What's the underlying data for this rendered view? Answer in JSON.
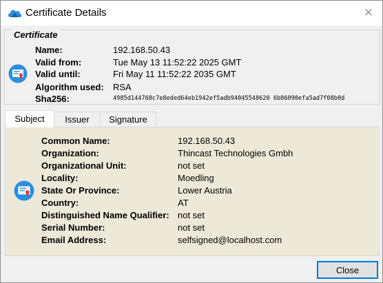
{
  "window": {
    "title": "Certificate Details",
    "close_glyph": "✕"
  },
  "certificate": {
    "legend": "Certificate",
    "fields": [
      {
        "label": "Name:",
        "value": "192.168.50.43"
      },
      {
        "label": "Valid from:",
        "value": "Tue May 13 11:52:22 2025 GMT"
      },
      {
        "label": "Valid until:",
        "value": "Fri May 11 11:52:22 2035 GMT"
      },
      {
        "label": "Algorithm used:",
        "value": "RSA"
      },
      {
        "label": "Sha256:",
        "value": "4985d144768c7e8eded64eb1942ef5adb94045548620 6b86090efa5ad7f08b0d"
      }
    ]
  },
  "tabs": [
    {
      "label": "Subject",
      "active": true
    },
    {
      "label": "Issuer",
      "active": false
    },
    {
      "label": "Signature",
      "active": false
    }
  ],
  "subject": {
    "rows": [
      {
        "label": "Common Name:",
        "value": "192.168.50.43"
      },
      {
        "label": "Organization:",
        "value": "Thincast Technologies Gmbh"
      },
      {
        "label": "Organizational Unit:",
        "value": "not set"
      },
      {
        "label": "Locality:",
        "value": "Moedling"
      },
      {
        "label": "State Or Province:",
        "value": "Lower Austria"
      },
      {
        "label": "Country:",
        "value": "AT"
      },
      {
        "label": "Distinguished Name Qualifier:",
        "value": "not set"
      },
      {
        "label": "Serial Number:",
        "value": "not set"
      },
      {
        "label": "Email Address:",
        "value": "selfsigned@localhost.com"
      }
    ]
  },
  "buttons": {
    "close_label": "Close"
  },
  "icons": {
    "app": "cloud-icon",
    "certificate": "certificate-icon",
    "subject": "certificate-icon"
  },
  "colors": {
    "accent": "#0078d7",
    "icon_blue": "#2b8fe0",
    "subject_bg": "#ece9d8"
  }
}
